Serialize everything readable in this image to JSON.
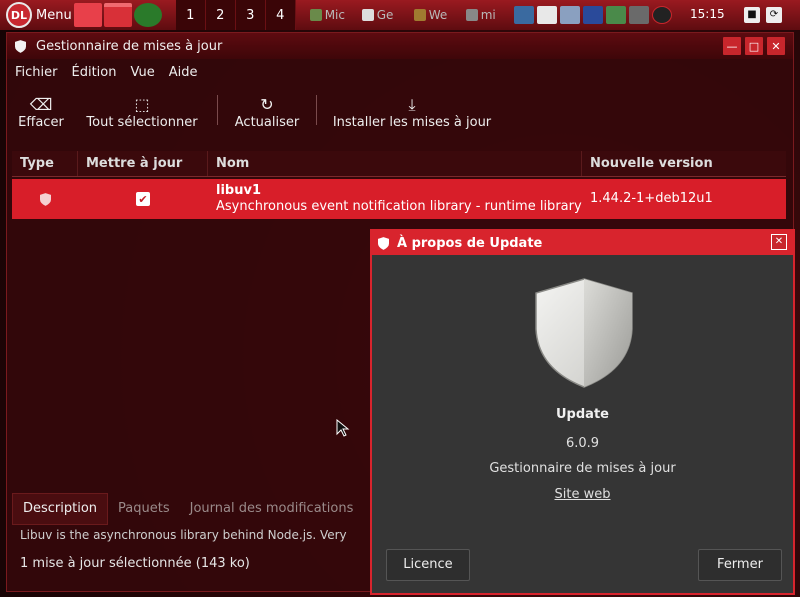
{
  "panel": {
    "menu_label": "Menu",
    "workspaces": [
      "1",
      "2",
      "3",
      "4"
    ],
    "tasks": [
      "Mic",
      "Ge",
      "We",
      "mi"
    ],
    "clock": "15:15"
  },
  "window": {
    "title": "Gestionnaire de mises à jour",
    "menu": [
      "Fichier",
      "Édition",
      "Vue",
      "Aide"
    ],
    "toolbar": {
      "clear": "Effacer",
      "select_all": "Tout sélectionner",
      "refresh": "Actualiser",
      "install": "Installer les mises à jour"
    },
    "columns": [
      "Type",
      "Mettre à jour",
      "Nom",
      "Nouvelle version"
    ],
    "rows": [
      {
        "name": "libuv1",
        "description": "Asynchronous event notification library - runtime library",
        "version": "1.44.2-1+deb12u1",
        "selected": true
      }
    ],
    "tabs": [
      "Description",
      "Paquets",
      "Journal des modifications"
    ],
    "description_text": "Libuv is the asynchronous library behind Node.js. Very",
    "status": "1 mise à jour sélectionnée (143 ko)"
  },
  "about": {
    "title": "À propos de Update",
    "app_name": "Update",
    "version": "6.0.9",
    "description": "Gestionnaire de mises à jour",
    "website": "Site web",
    "licence_button": "Licence",
    "close_button": "Fermer"
  },
  "colors": {
    "accent": "#d81e29",
    "panel": "#7a1418",
    "dialog_bg": "#353535"
  }
}
